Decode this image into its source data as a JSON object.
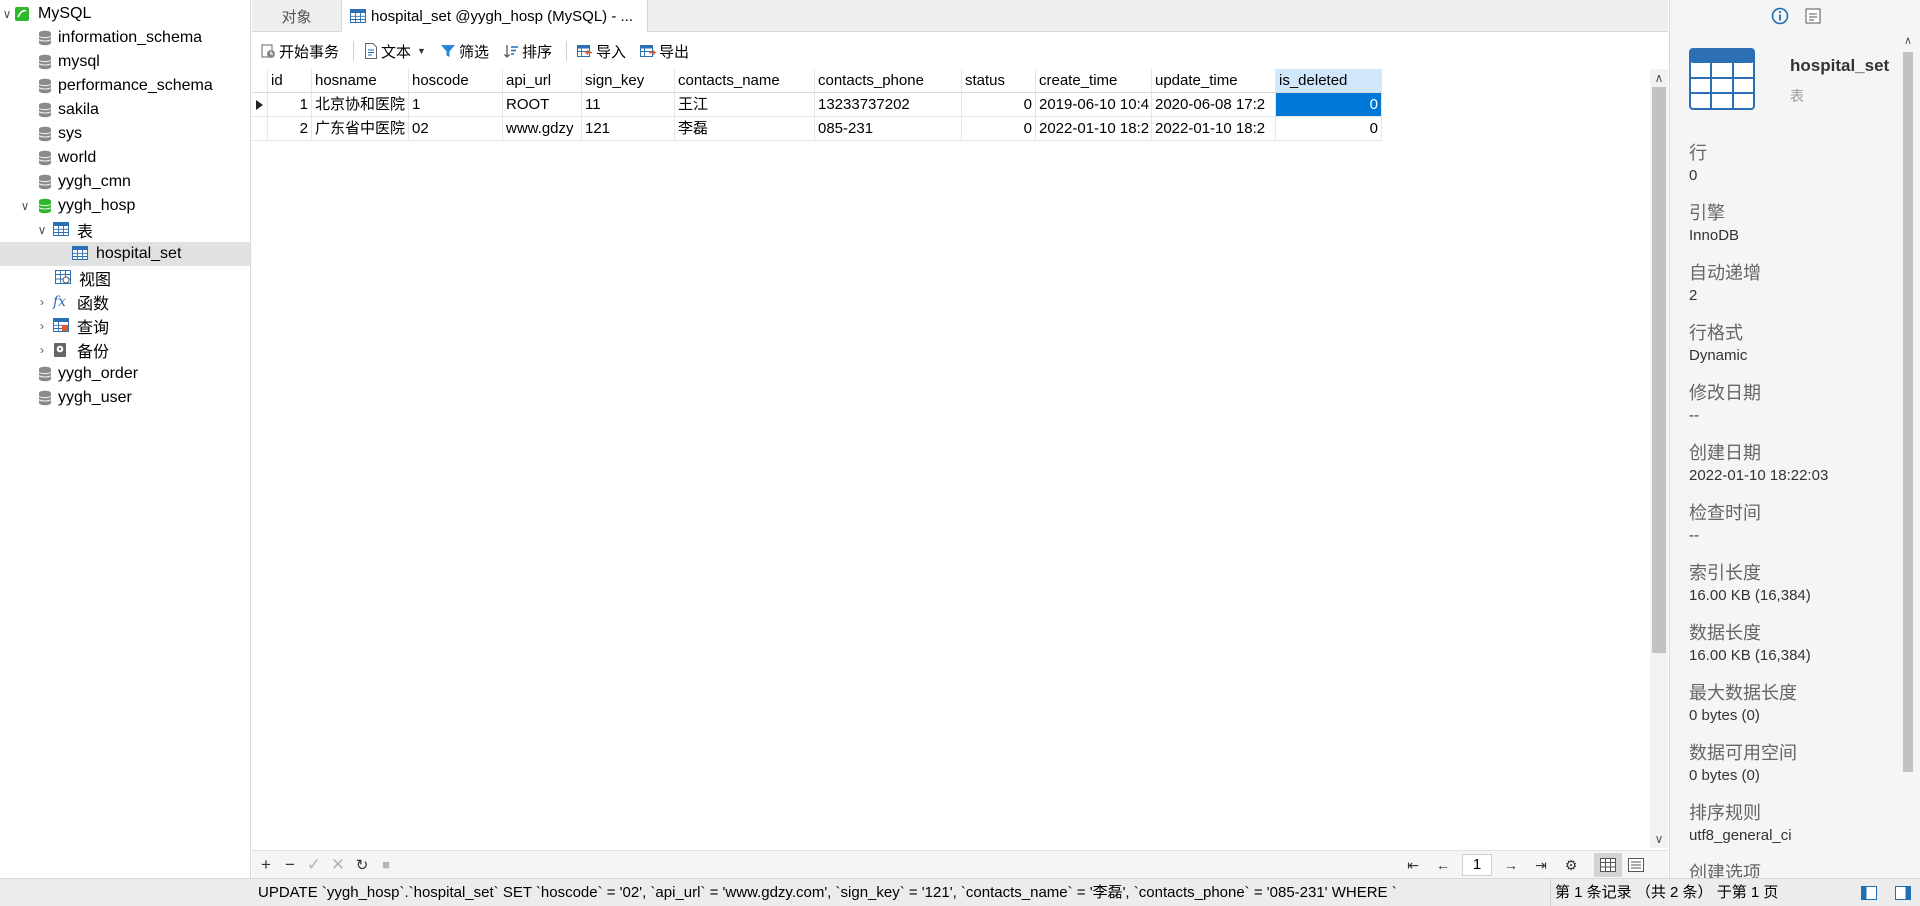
{
  "sidebar": {
    "connection": "MySQL",
    "databases": [
      {
        "label": "information_schema"
      },
      {
        "label": "mysql"
      },
      {
        "label": "performance_schema"
      },
      {
        "label": "sakila"
      },
      {
        "label": "sys"
      },
      {
        "label": "world"
      },
      {
        "label": "yygh_cmn"
      },
      {
        "label": "yygh_hosp"
      },
      {
        "label": "yygh_order"
      },
      {
        "label": "yygh_user"
      }
    ],
    "yygh_hosp_children": {
      "tables": "表",
      "table_item": "hospital_set",
      "views": "视图",
      "functions": "函数",
      "queries": "查询",
      "backups": "备份"
    }
  },
  "tabs": {
    "objects": "对象",
    "active": "hospital_set @yygh_hosp (MySQL) - ..."
  },
  "toolbar": {
    "begin_transaction": "开始事务",
    "text": "文本",
    "filter": "筛选",
    "sort": "排序",
    "import": "导入",
    "export": "导出"
  },
  "grid": {
    "columns": [
      "id",
      "hosname",
      "hoscode",
      "api_url",
      "sign_key",
      "contacts_name",
      "contacts_phone",
      "status",
      "create_time",
      "update_time",
      "is_deleted"
    ],
    "rows": [
      [
        "1",
        "北京协和医院",
        "1",
        "ROOT",
        "11",
        "王江",
        "13233737202",
        "0",
        "2019-06-10 10:4",
        "2020-06-08 17:2",
        "0"
      ],
      [
        "2",
        "广东省中医院",
        "02",
        "www.gdzy",
        "121",
        "李磊",
        "085-231",
        "0",
        "2022-01-10 18:2",
        "2022-01-10 18:2",
        "0"
      ]
    ]
  },
  "pager": {
    "page": "1"
  },
  "status": {
    "sql": "UPDATE `yygh_hosp`.`hospital_set` SET `hoscode` = '02', `api_url` = 'www.gdzy.com', `sign_key` = '121', `contacts_name` = '李磊', `contacts_phone` = '085-231' WHERE `",
    "records": "第 1 条记录 （共 2 条） 于第 1 页"
  },
  "info": {
    "name": "hospital_set",
    "type": "表",
    "props": [
      {
        "label": "行",
        "value": "0"
      },
      {
        "label": "引擎",
        "value": "InnoDB"
      },
      {
        "label": "自动递增",
        "value": "2"
      },
      {
        "label": "行格式",
        "value": "Dynamic"
      },
      {
        "label": "修改日期",
        "value": "--"
      },
      {
        "label": "创建日期",
        "value": "2022-01-10 18:22:03"
      },
      {
        "label": "检查时间",
        "value": "--"
      },
      {
        "label": "索引长度",
        "value": "16.00 KB (16,384)"
      },
      {
        "label": "数据长度",
        "value": "16.00 KB (16,384)"
      },
      {
        "label": "最大数据长度",
        "value": "0 bytes (0)"
      },
      {
        "label": "数据可用空间",
        "value": "0 bytes (0)"
      },
      {
        "label": "排序规则",
        "value": "utf8_general_ci"
      },
      {
        "label": "创建选项",
        "value": ""
      }
    ]
  },
  "colors": {
    "selection": "#0078d7",
    "mysql_green": "#2eb82e",
    "toolbar_blue": "#1f6fb5"
  }
}
